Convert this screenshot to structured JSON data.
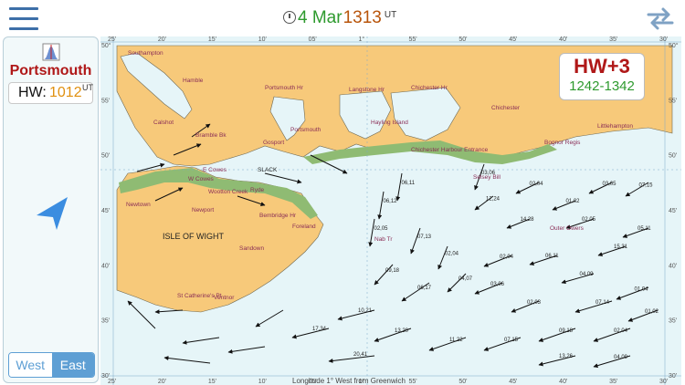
{
  "header": {
    "date": "4 Mar",
    "time": "1313",
    "time_unit": "UT"
  },
  "port": {
    "name": "Portsmouth",
    "hw_label": "HW:",
    "hw_time": "1012",
    "hw_unit": "UT"
  },
  "tide_overlay": {
    "offset": "HW+3",
    "range": "1242-1342"
  },
  "direction_toggle": {
    "west": "West",
    "east": "East",
    "selected": "East"
  },
  "map": {
    "lat_ticks": [
      "50°",
      "55'",
      "50'",
      "45'",
      "40'",
      "35'",
      "30'"
    ],
    "lon_ticks": [
      "25'",
      "20'",
      "15'",
      "10'",
      "05'",
      "1°",
      "55'",
      "50'",
      "45'",
      "40'",
      "35'",
      "30'"
    ],
    "bottom_caption": "Longitude 1° West from Greenwich",
    "places": [
      "Southampton",
      "Hamble",
      "Calshot",
      "Portsmouth Hr",
      "Portsmouth",
      "Gosport",
      "Langstone Hr",
      "Hayling Island",
      "Chichester Hr",
      "Chichester",
      "Chichester Harbour Entrance",
      "Littlehampton",
      "Bognor Regis",
      "Selsey Bill",
      "Bramble Bk",
      "W Cowes",
      "E Cowes",
      "Wootton Creek",
      "Ryde",
      "Newport",
      "Newtown",
      "Bembridge Hr",
      "Foreland",
      "Sandown",
      "Ventnor",
      "St Catherine's Pt",
      "ISLE OF WIGHT",
      "Nab Tr",
      "Outer Owers",
      "SLACK"
    ],
    "rates": [
      "04,09",
      "15,31",
      "05,11",
      "07,14",
      "01,04",
      "09,18",
      "02,04",
      "01,02",
      "02,03",
      "03,06",
      "02,04",
      "06,11",
      "02,05",
      "07,15",
      "03,05",
      "01,02",
      "02,04",
      "14,28",
      "12,24",
      "03,06",
      "06,11",
      "06,12",
      "02,05",
      "07,13",
      "02,04",
      "04,07",
      "06,17",
      "09,18",
      "10,21",
      "13,20",
      "11,22",
      "07,15",
      "13,26",
      "04,09",
      "17,34",
      "20,41"
    ],
    "colors": {
      "sea": "#e6f5f8",
      "land": "#f7c97a",
      "mud": "#8fbb73",
      "place_text": "#8a2d56",
      "arrow": "#111111"
    }
  }
}
